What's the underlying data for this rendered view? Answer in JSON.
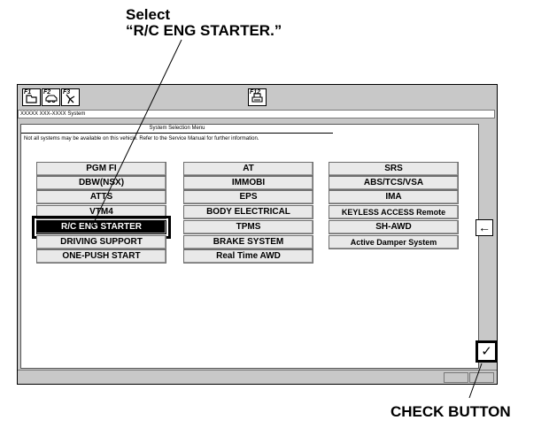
{
  "callouts": {
    "select_line1": "Select",
    "select_line2": "“R/C ENG STARTER.”",
    "check_button": "CHECK BUTTON"
  },
  "fkeys": [
    {
      "label": "F1",
      "icon": "folder-icon"
    },
    {
      "label": "F2",
      "icon": "car-icon"
    },
    {
      "label": "F3",
      "icon": "tool-icon"
    },
    {
      "label": "F12",
      "icon": "print-icon"
    }
  ],
  "system_bar": "XXXXX XXX-XXXX System",
  "menu": {
    "title": "System Selection Menu",
    "info": "Not all systems may be available on this vehicle. Refer to the Service Manual for further information.",
    "columns": [
      [
        "PGM FI",
        "DBW(NSX)",
        "ATTS",
        "VTM4",
        "R/C ENG STARTER",
        "DRIVING SUPPORT",
        "ONE-PUSH START"
      ],
      [
        "AT",
        "IMMOBI",
        "EPS",
        "BODY ELECTRICAL",
        "TPMS",
        "BRAKE SYSTEM",
        "Real Time AWD"
      ],
      [
        "SRS",
        "ABS/TCS/VSA",
        "IMA",
        "KEYLESS ACCESS Remote",
        "SH-AWD",
        "Active Damper System"
      ]
    ],
    "selected": "R/C ENG STARTER"
  },
  "side_buttons": {
    "back": "←",
    "check": "✓"
  }
}
